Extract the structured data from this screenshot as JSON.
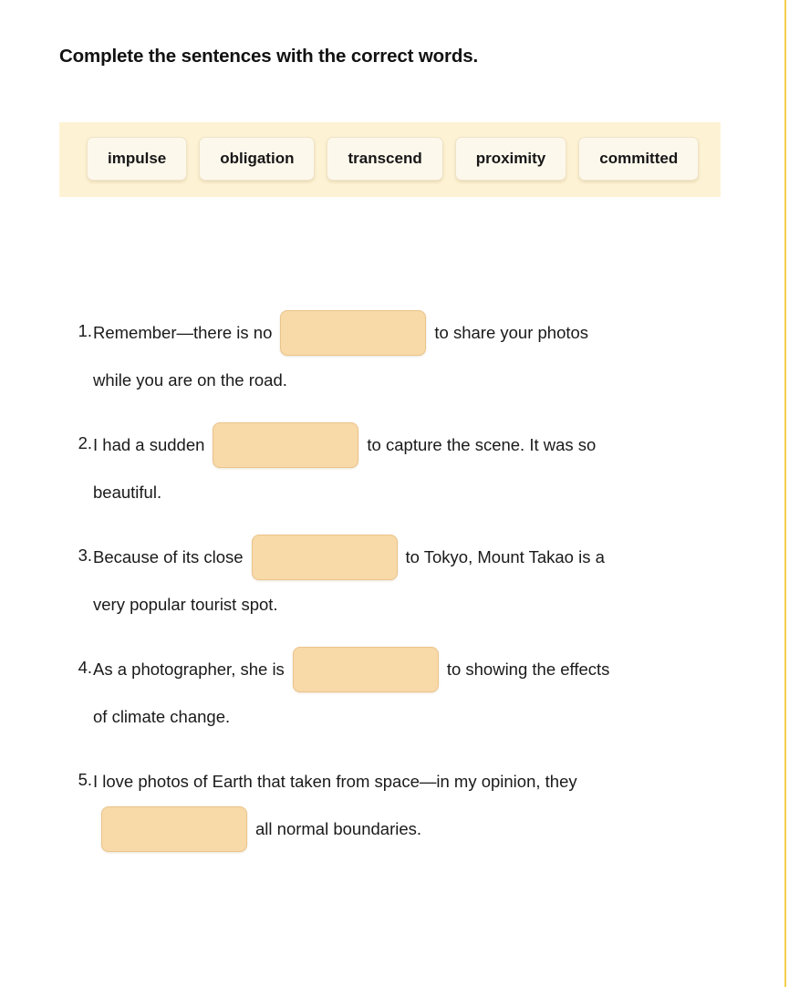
{
  "page": {
    "title": "Complete the sentences with the correct words.",
    "edge_rule_color": "#f5cf4e",
    "band_color": "#fdf3d4",
    "chip_color": "#fdf8ec",
    "blank_color": "#f8d9a8"
  },
  "word_bank": {
    "words": [
      {
        "label": "impulse"
      },
      {
        "label": "obligation"
      },
      {
        "label": "transcend"
      },
      {
        "label": "proximity"
      },
      {
        "label": "committed"
      }
    ]
  },
  "questions": [
    {
      "number": "1.",
      "line1_before": "Remember—there is no",
      "line1_after": "to share your photos",
      "line2": "while you are on the road.",
      "blank_on_line": 1
    },
    {
      "number": "2.",
      "line1_before": "I had a sudden",
      "line1_after": "to capture the scene. It was so",
      "line2": "beautiful.",
      "blank_on_line": 1
    },
    {
      "number": "3.",
      "line1_before": "Because of its close",
      "line1_after": "to Tokyo, Mount Takao is a",
      "line2": "very popular tourist spot.",
      "blank_on_line": 1
    },
    {
      "number": "4.",
      "line1_before": "As a photographer, she is",
      "line1_after": "to showing the effects",
      "line2": "of climate change.",
      "blank_on_line": 1
    },
    {
      "number": "5.",
      "line1_before": "I love photos of Earth that taken from space—in my opinion, they",
      "line1_after": "",
      "line2": "all normal boundaries.",
      "blank_on_line": 2
    }
  ]
}
